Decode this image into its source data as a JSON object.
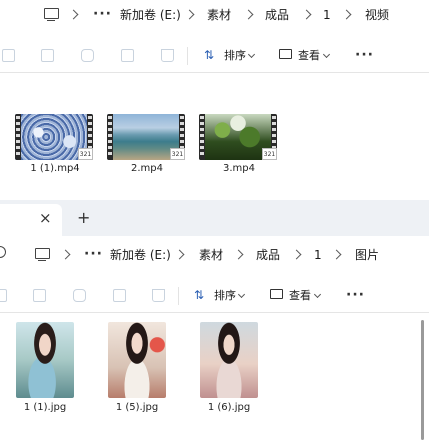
{
  "top_window": {
    "breadcrumb": [
      "新加卷 (E:)",
      "素材",
      "成品",
      "1",
      "视频"
    ],
    "more_label": "···",
    "sort_label": "排序",
    "view_label": "查看",
    "overflow_label": "···",
    "files": [
      {
        "name": "1 (1).mp4"
      },
      {
        "name": "2.mp4"
      },
      {
        "name": "3.mp4"
      }
    ]
  },
  "bottom_window": {
    "tab": {
      "close_glyph": "×",
      "new_tab_glyph": "+"
    },
    "breadcrumb": [
      "新加卷 (E:)",
      "素材",
      "成品",
      "1",
      "图片"
    ],
    "more_label": "···",
    "sort_label": "排序",
    "view_label": "查看",
    "overflow_label": "···",
    "files": [
      {
        "name": "1 (1).jpg"
      },
      {
        "name": "1 (5).jpg"
      },
      {
        "name": "1 (6).jpg"
      }
    ]
  }
}
